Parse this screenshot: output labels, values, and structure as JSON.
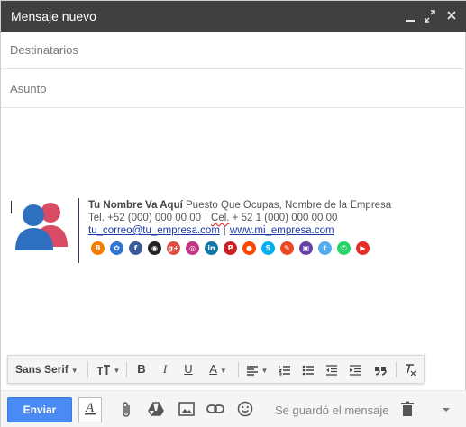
{
  "window": {
    "title": "Mensaje nuevo"
  },
  "fields": {
    "to_placeholder": "Destinatarios",
    "subject_placeholder": "Asunto"
  },
  "signature": {
    "name": "Tu Nombre Va Aquí",
    "position": "Puesto Que Ocupas, Nombre de la Empresa",
    "tel_label": "Tel.",
    "tel": "+52 (000) 000 00 00",
    "cel_label": "Cel.",
    "cel": "+ 52 1 (000) 000 00 00",
    "separator": "|",
    "email": "tu_correo@tu_empresa.com",
    "website": "www.mi_empresa.com",
    "social": [
      {
        "name": "blogger-icon",
        "color": "#f57d00",
        "glyph": "B"
      },
      {
        "name": "delicious-icon",
        "color": "#3274d1",
        "glyph": "✿"
      },
      {
        "name": "facebook-icon",
        "color": "#3b5998",
        "glyph": "f"
      },
      {
        "name": "github-icon",
        "color": "#222222",
        "glyph": "◉"
      },
      {
        "name": "google-plus-icon",
        "color": "#dc4e41",
        "glyph": "g+"
      },
      {
        "name": "instagram-icon",
        "color": "#c13584",
        "glyph": "◎"
      },
      {
        "name": "linkedin-icon",
        "color": "#0e76a8",
        "glyph": "in"
      },
      {
        "name": "pinterest-icon",
        "color": "#cb2027",
        "glyph": "P"
      },
      {
        "name": "reddit-icon",
        "color": "#ff4500",
        "glyph": "●"
      },
      {
        "name": "skype-icon",
        "color": "#00aff0",
        "glyph": "S"
      },
      {
        "name": "stumbleupon-icon",
        "color": "#eb4924",
        "glyph": "✎"
      },
      {
        "name": "twitch-icon",
        "color": "#6441a5",
        "glyph": "▣"
      },
      {
        "name": "twitter-icon",
        "color": "#55acee",
        "glyph": "t"
      },
      {
        "name": "whatsapp-icon",
        "color": "#25d366",
        "glyph": "✆"
      },
      {
        "name": "youtube-icon",
        "color": "#e52d27",
        "glyph": "▶"
      }
    ]
  },
  "format_bar": {
    "font": "Sans Serif"
  },
  "bottom_bar": {
    "send_label": "Enviar",
    "status": "Se guardó el mensaje"
  },
  "colors": {
    "titlebar": "#404040",
    "send_button": "#4a8af4"
  }
}
